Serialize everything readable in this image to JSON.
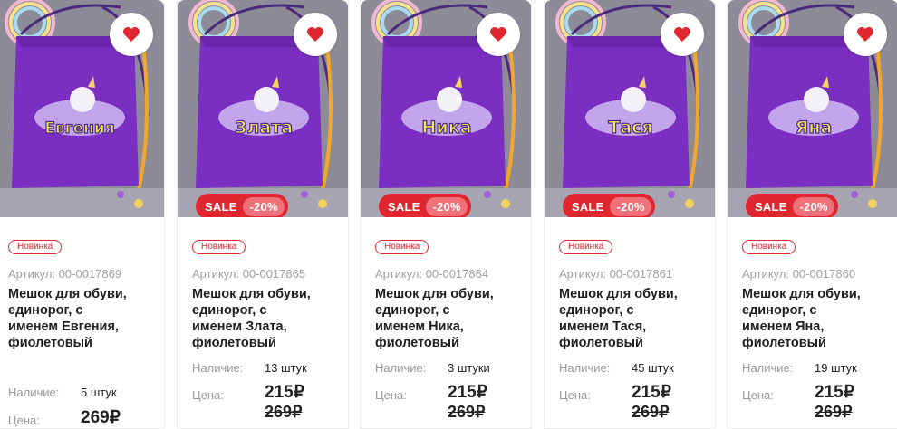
{
  "labels": {
    "stock": "Наличие:",
    "price": "Цена:",
    "favorite_icon": "heart-icon"
  },
  "colors": {
    "sale_red": "#e0262f",
    "price_teal": "#2bb3a7",
    "bag_purple": "#7a2fc2"
  },
  "products": [
    {
      "bag_name": "Евгения",
      "badge": "Новинка",
      "sku": "Артикул: 00-0017869",
      "title_lines": [
        "Мешок для обуви,",
        "единорог, с",
        "именем Евгения,",
        "фиолетовый"
      ],
      "stock": "5 штук",
      "price": "269₽",
      "old_price": "",
      "sale": "",
      "discount": ""
    },
    {
      "bag_name": "Злата",
      "badge": "Новинка",
      "sku": "Артикул: 00-0017865",
      "title_lines": [
        "Мешок для обуви,",
        "единорог, с",
        "именем Злата,",
        "фиолетовый"
      ],
      "stock": "13 штук",
      "price": "215₽",
      "old_price": "269₽",
      "sale": "SALE",
      "discount": "-20%"
    },
    {
      "bag_name": "Ника",
      "badge": "Новинка",
      "sku": "Артикул: 00-0017864",
      "title_lines": [
        "Мешок для обуви,",
        "единорог, с",
        "именем Ника,",
        "фиолетовый"
      ],
      "stock": "3 штуки",
      "price": "215₽",
      "old_price": "269₽",
      "sale": "SALE",
      "discount": "-20%"
    },
    {
      "bag_name": "Тася",
      "badge": "Новинка",
      "sku": "Артикул: 00-0017861",
      "title_lines": [
        "Мешок для обуви,",
        "единорог, с",
        "именем Тася,",
        "фиолетовый"
      ],
      "stock": "45 штук",
      "price": "215₽",
      "old_price": "269₽",
      "sale": "SALE",
      "discount": "-20%"
    },
    {
      "bag_name": "Яна",
      "badge": "Новинка",
      "sku": "Артикул: 00-0017860",
      "title_lines": [
        "Мешок для обуви,",
        "единорог, с",
        "именем Яна,",
        "фиолетовый"
      ],
      "stock": "19 штук",
      "price": "215₽",
      "old_price": "269₽",
      "sale": "SALE",
      "discount": "-20%"
    }
  ]
}
